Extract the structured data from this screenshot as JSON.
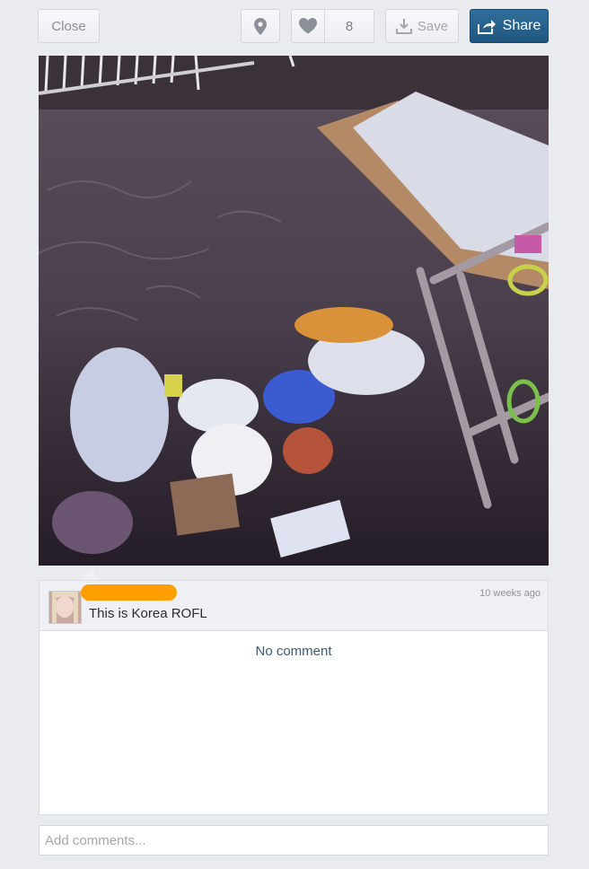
{
  "toolbar": {
    "close_label": "Close",
    "like_count": "8",
    "save_label": "Save",
    "share_label": "Share"
  },
  "post": {
    "caption": "This is Korea ROFL",
    "timestamp": "10 weeks ago"
  },
  "comments": {
    "empty_text": "No comment",
    "input_placeholder": "Add comments..."
  },
  "colors": {
    "share_button": "#1f5680",
    "redaction": "#ff9e00"
  },
  "icons": [
    "map-pin-icon",
    "heart-icon",
    "download-icon",
    "share-icon"
  ]
}
